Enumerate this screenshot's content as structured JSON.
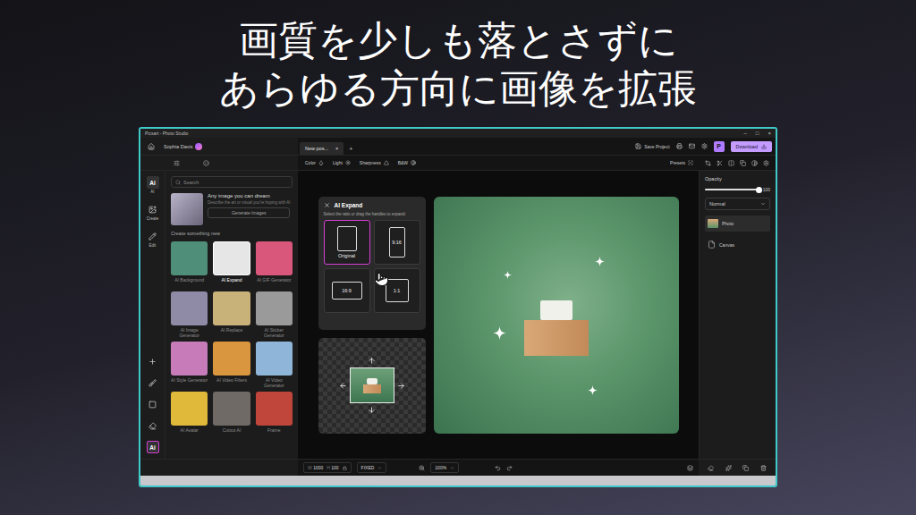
{
  "headline": [
    "画質を少しも落とさずに",
    "あらゆる方向に画像を拡張"
  ],
  "window": {
    "title": "Picsart - Photo Studio",
    "controls": [
      "–",
      "□",
      "×"
    ]
  },
  "header": {
    "user": "Sophia Davis",
    "tabs": [
      {
        "label": "New pos...",
        "close": "×",
        "selected": true
      }
    ],
    "new_tab": "+",
    "save": "Save Project",
    "plan_badge": "P",
    "download": "Download"
  },
  "toolbar": {
    "tools": [
      {
        "label": "Color",
        "kind": "color"
      },
      {
        "label": "Light",
        "kind": "light"
      },
      {
        "label": "Sharpness",
        "kind": "sharpness"
      },
      {
        "label": "B&W",
        "kind": "bw"
      }
    ],
    "presets": "Presets"
  },
  "rail": {
    "top": [
      {
        "kind": "ai",
        "label": "Ai",
        "caption": "AI",
        "selected": true
      },
      {
        "kind": "create",
        "caption": "Create",
        "selected": false
      },
      {
        "kind": "edit",
        "caption": "Edit",
        "selected": false
      }
    ],
    "bottom": [
      {
        "kind": "add",
        "selected": false
      },
      {
        "kind": "brush",
        "selected": false
      },
      {
        "kind": "frame",
        "selected": false
      },
      {
        "kind": "eraser",
        "selected": false
      },
      {
        "kind": "ai",
        "label": "Ai",
        "selected": true
      }
    ]
  },
  "panel": {
    "search": {
      "placeholder": "Search"
    },
    "promo": {
      "title": "Any image you can dream",
      "text": "Describe the art or visual you're hoping with AI",
      "button": "Generate Images"
    },
    "section": "Create something new",
    "tools": [
      {
        "name": "AI Background",
        "color": "#4f8f7a",
        "selected": false
      },
      {
        "name": "AI Expand",
        "color": "#e6e6e6",
        "selected": true
      },
      {
        "name": "AI GIF Generator",
        "color": "#d9577a",
        "selected": false
      },
      {
        "name": "AI Image Generator",
        "color": "#8f8aa6",
        "selected": false
      },
      {
        "name": "AI Replace",
        "color": "#c9b27a",
        "selected": false
      },
      {
        "name": "AI Sticker Generator",
        "color": "#9a9a9a",
        "selected": false
      },
      {
        "name": "AI Style Generator",
        "color": "#c77bb8",
        "selected": false
      },
      {
        "name": "AI Video Filters",
        "color": "#d9963f",
        "selected": false
      },
      {
        "name": "AI Video Generator",
        "color": "#8fb6d9",
        "selected": false
      },
      {
        "name": "AI Avatar",
        "color": "#e0b83a",
        "selected": false
      },
      {
        "name": "Cutout AI",
        "color": "#6f6a66",
        "selected": false
      },
      {
        "name": "Frame",
        "color": "#c0453a",
        "selected": false
      }
    ]
  },
  "expand": {
    "title": "AI Expand",
    "close": "×",
    "hint": "Select the ratio or drag the handles to expand:",
    "ratios": [
      {
        "label": "Original",
        "kind": "original",
        "selected": true
      },
      {
        "label": "9:16",
        "kind": "portrait",
        "selected": false
      },
      {
        "label": "16:9",
        "kind": "landscape",
        "selected": false
      },
      {
        "label": "1:1",
        "kind": "square",
        "selected": false
      }
    ]
  },
  "layers_panel": {
    "opacity": {
      "label": "Opacity",
      "level": 1,
      "reading": "100"
    },
    "blend": "Normal",
    "layers": [
      {
        "name": "Photo",
        "kind": "image",
        "selected": true
      },
      {
        "name": "Canvas",
        "kind": "canvas",
        "selected": false
      }
    ]
  },
  "bottom_bar": {
    "width_label": "W",
    "width": "1000",
    "height_label": "H",
    "height": "100",
    "mode": "FIXED",
    "zoom": "100%"
  }
}
